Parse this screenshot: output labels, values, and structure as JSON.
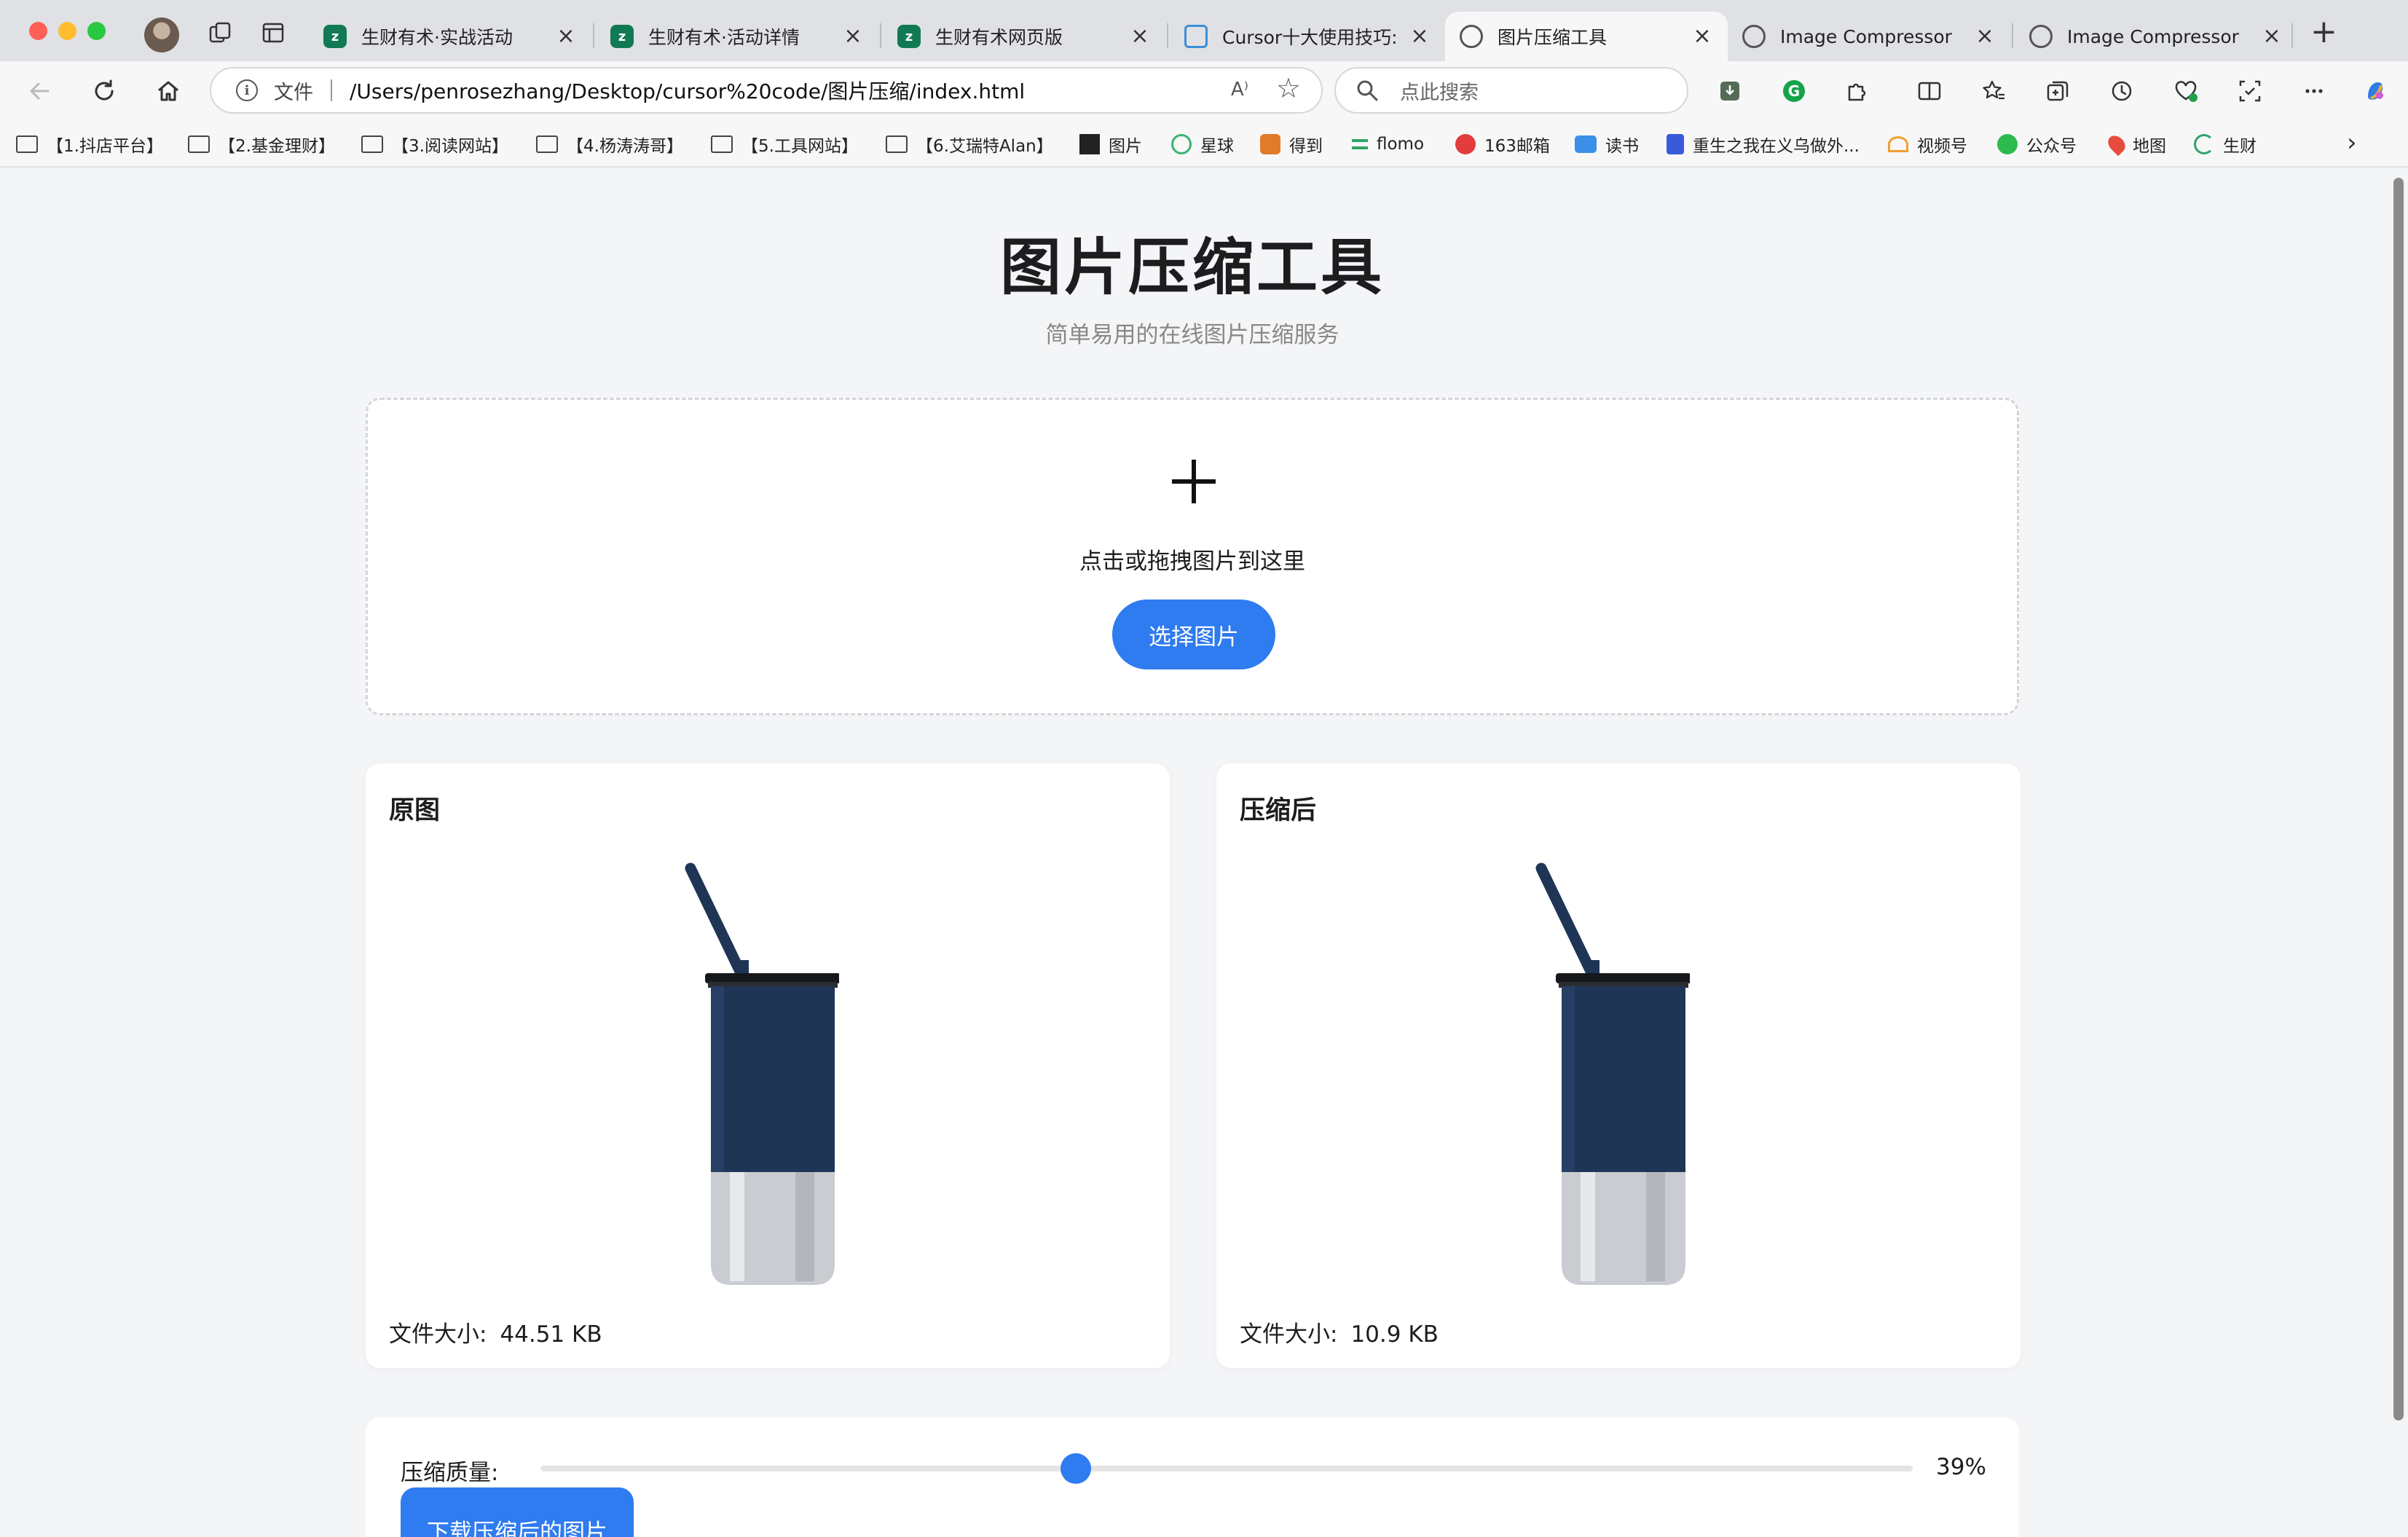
{
  "browser": {
    "tabs": [
      {
        "title": "生财有术·实战活动",
        "icon": "shengcai-favicon"
      },
      {
        "title": "生财有术·活动详情",
        "icon": "shengcai-favicon"
      },
      {
        "title": "生财有术网页版",
        "icon": "shengcai-favicon"
      },
      {
        "title": "Cursor十大使用技巧: 免",
        "icon": "bilibili-favicon"
      },
      {
        "title": "图片压缩工具",
        "icon": "globe-icon",
        "active": true
      },
      {
        "title": "Image Compressor",
        "icon": "globe-icon"
      },
      {
        "title": "Image Compressor",
        "icon": "globe-icon"
      }
    ],
    "tab_close": "×",
    "new_tab": "+",
    "address": {
      "scheme_label": "文件",
      "url": "/Users/penrosezhang/Desktop/cursor%20code/图片压缩/index.html",
      "read_aloud": "A⁾"
    },
    "search": {
      "placeholder": "点此搜索"
    },
    "bookmarks": [
      {
        "label": "【1.抖店平台】",
        "icon": "folder-icon"
      },
      {
        "label": "【2.基金理财】",
        "icon": "folder-icon"
      },
      {
        "label": "【3.阅读网站】",
        "icon": "folder-icon"
      },
      {
        "label": "【4.杨涛涛哥】",
        "icon": "folder-icon"
      },
      {
        "label": "【5.工具网站】",
        "icon": "folder-icon"
      },
      {
        "label": "【6.艾瑞特Alan】",
        "icon": "folder-icon"
      },
      {
        "label": "图片",
        "icon": "unsplash-icon"
      },
      {
        "label": "星球",
        "icon": "planet-icon"
      },
      {
        "label": "得到",
        "icon": "dedao-icon"
      },
      {
        "label": "flomo",
        "icon": "flomo-icon"
      },
      {
        "label": "163邮箱",
        "icon": "mail-icon"
      },
      {
        "label": "读书",
        "icon": "book-icon"
      },
      {
        "label": "重生之我在义乌做外...",
        "icon": "doc-icon"
      },
      {
        "label": "视频号",
        "icon": "channels-icon"
      },
      {
        "label": "公众号",
        "icon": "wechat-icon"
      },
      {
        "label": "地图",
        "icon": "map-pin-icon"
      },
      {
        "label": "生财",
        "icon": "shengcai-icon"
      }
    ]
  },
  "page": {
    "title": "图片压缩工具",
    "subtitle": "简单易用的在线图片压缩服务",
    "upload": {
      "hint": "点击或拖拽图片到这里",
      "button": "选择图片"
    },
    "original": {
      "title": "原图",
      "size_label": "文件大小:",
      "size_value": "44.51 KB",
      "image": "tumbler-photo"
    },
    "compressed": {
      "title": "压缩后",
      "size_label": "文件大小:",
      "size_value": "10.9 KB",
      "image": "tumbler-photo"
    },
    "controls": {
      "quality_label": "压缩质量:",
      "quality_value": "39%",
      "quality_fraction": 0.39,
      "download_button": "下载压缩后的图片"
    }
  },
  "colors": {
    "accent": "#2f7bf0",
    "tumbler_body": "#1f3556",
    "tumbler_steel": "#c9ccd0"
  }
}
